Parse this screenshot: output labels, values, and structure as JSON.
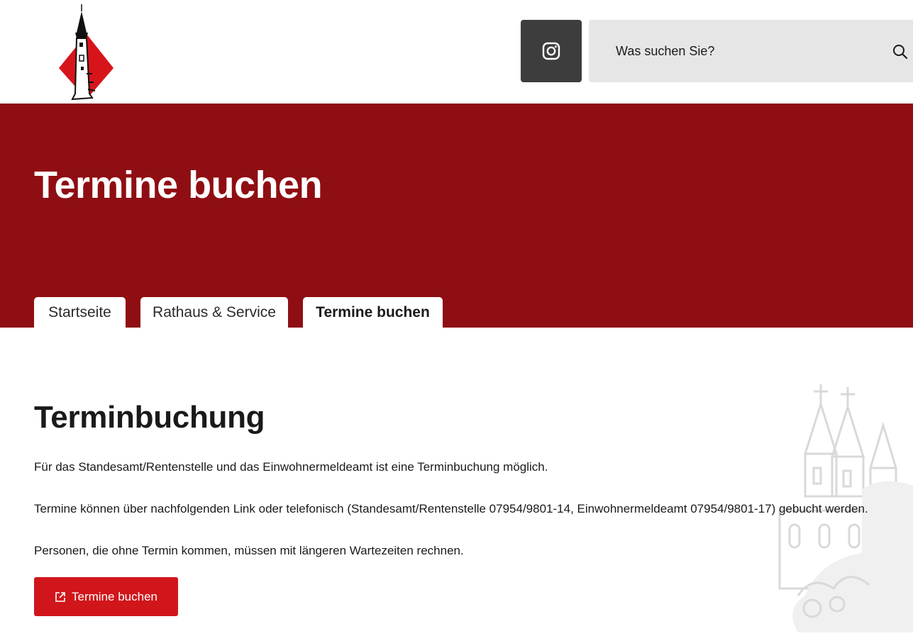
{
  "header": {
    "logo_icon": "church-tower-logo",
    "instagram_icon": "instagram-icon",
    "search": {
      "placeholder": "Was suchen Sie?",
      "value": "",
      "icon": "search-icon"
    }
  },
  "hero": {
    "title": "Termine buchen",
    "background_color": "#8f0e13"
  },
  "breadcrumb": [
    {
      "label": "Startseite",
      "active": false
    },
    {
      "label": "Rathaus & Service",
      "active": false
    },
    {
      "label": "Termine buchen",
      "active": true
    }
  ],
  "main": {
    "title": "Terminbuchung",
    "paragraphs": [
      "Für das Standesamt/Rentenstelle und das Einwohnermeldeamt ist eine Terminbuchung möglich.",
      "Termine können über nachfolgenden Link oder telefonisch (Standesamt/Rentenstelle 07954/9801-14, Einwohnermeldeamt 07954/9801-17) gebucht werden.",
      "Personen, die ohne Termin kommen, müssen mit längeren Wartezeiten rechnen."
    ],
    "button": {
      "label": "Termine buchen",
      "icon": "external-link-icon",
      "color": "#d0161b"
    },
    "watermark_icon": "church-watermark-icon"
  }
}
